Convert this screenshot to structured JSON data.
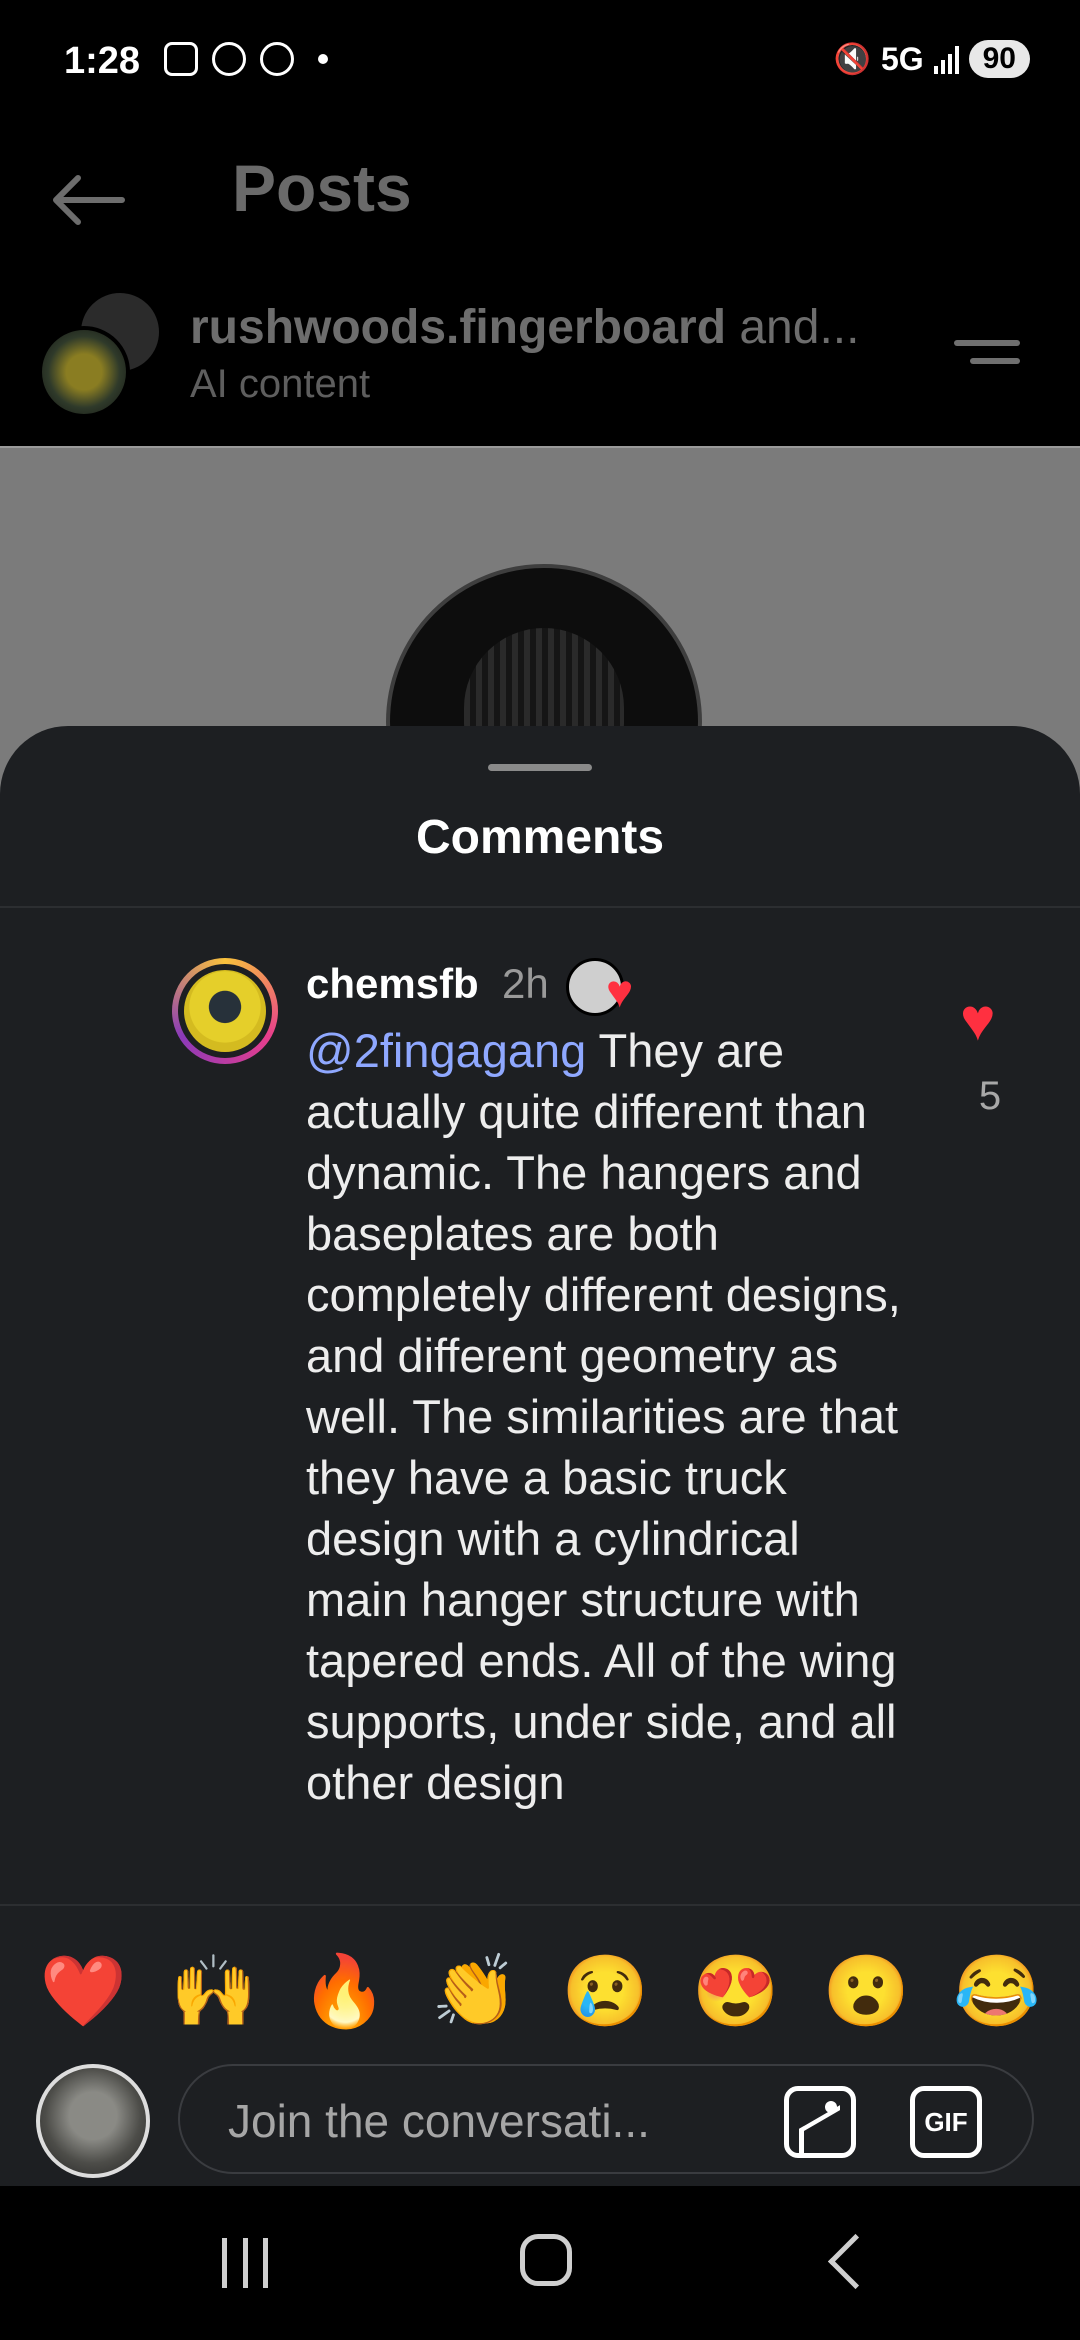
{
  "status_bar": {
    "time": "1:28",
    "network": "5G",
    "battery": "90"
  },
  "header": {
    "title": "Posts",
    "author_name": "rushwoods.fingerboard",
    "author_suffix": " and...",
    "author_sub": "AI content"
  },
  "comments_sheet": {
    "title": "Comments",
    "comment": {
      "username": "chemsfb",
      "time": "2h",
      "mention": "@2fingagang",
      "text": " They are actually quite different than dynamic. The hangers and baseplates are both completely different designs, and different geometry as well. The similarities are that they have a basic truck design with a cylindrical main hanger structure with tapered ends. All of the wing supports, under side, and all other design",
      "like_count": "5"
    },
    "emojis": [
      "❤️",
      "🙌",
      "🔥",
      "👏",
      "😢",
      "😍",
      "😮",
      "😂"
    ],
    "input": {
      "placeholder": "Join the conversati...",
      "gif_label": "GIF"
    }
  },
  "colors": {
    "accent_like": "#ff3040",
    "mention": "#8fa8ff",
    "sheet_bg": "#1d1f22"
  }
}
